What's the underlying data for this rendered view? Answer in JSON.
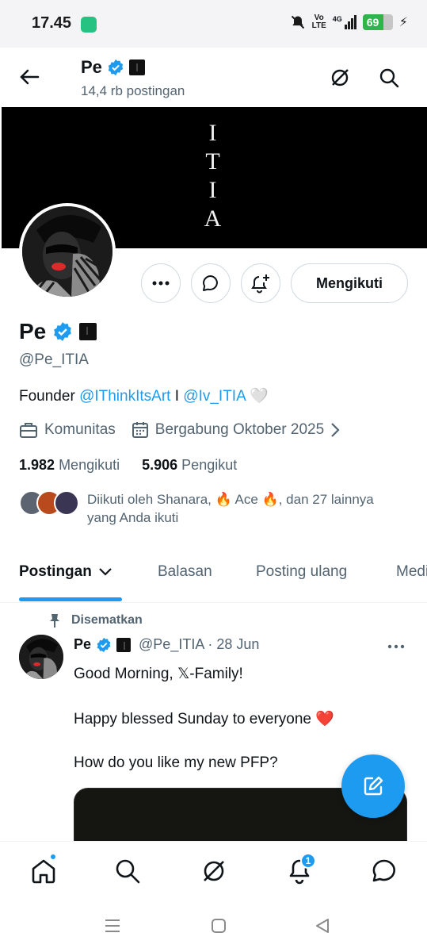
{
  "status_bar": {
    "time": "17.45",
    "volte_top": "Vo",
    "volte_bottom": "LTE",
    "network": "4G",
    "battery": "69",
    "battery_level": 0.69
  },
  "header": {
    "name": "Pe",
    "posts_count": "14,4 rb postingan"
  },
  "banner": {
    "letters": [
      "I",
      "T",
      "I",
      "A"
    ]
  },
  "profile": {
    "follow_button": "Mengikuti",
    "name": "Pe",
    "handle": "@Pe_ITIA",
    "bio_prefix": "Founder",
    "bio_link1": "@IThinkItsArt",
    "bio_sep": "I",
    "bio_link2": "@Iv_ITIA",
    "bio_emoji": "🤍",
    "community": "Komunitas",
    "joined": "Bergabung Oktober 2025",
    "following_count": "1.982",
    "following_label": "Mengikuti",
    "followers_count": "5.906",
    "followers_label": "Pengikut",
    "followed_by": "Diikuti oleh Shanara, 🔥 Ace 🔥, dan 27 lainnya yang Anda ikuti"
  },
  "tabs": [
    "Postingan",
    "Balasan",
    "Posting ulang",
    "Media"
  ],
  "tweet": {
    "pinned_label": "Disematkan",
    "name": "Pe",
    "handle_date": "@Pe_ITIA · 28 Jun",
    "line1": "Good Morning, 𝕏-Family!",
    "line2": "Happy blessed Sunday to everyone ❤️",
    "line3": "How do you like my new PFP?"
  },
  "bottom_nav": {
    "items": [
      "home-icon",
      "search-icon",
      "grok-icon",
      "bell-icon",
      "chat-icon"
    ],
    "notifications_badge": "1"
  },
  "colors": {
    "accent": "#1d9bf0",
    "text": "#0f1419",
    "muted": "#536471"
  }
}
